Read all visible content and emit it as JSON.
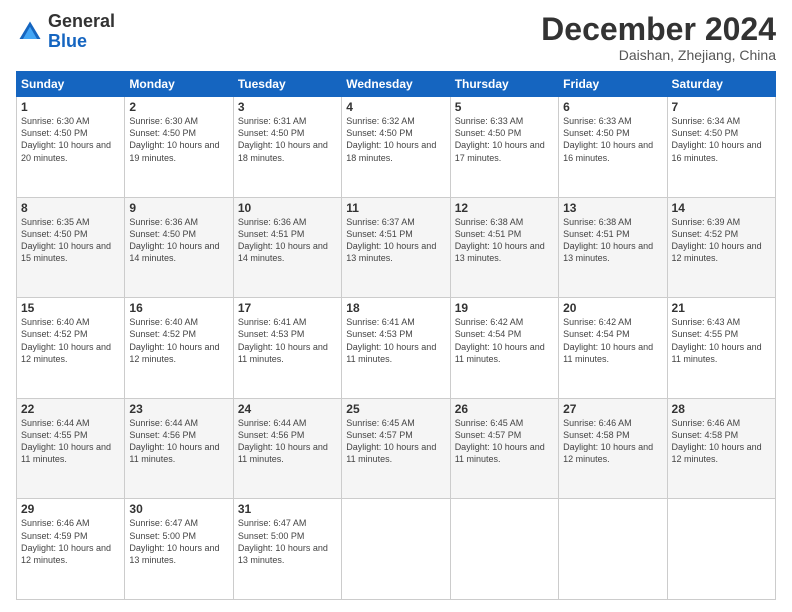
{
  "logo": {
    "general": "General",
    "blue": "Blue"
  },
  "header": {
    "month": "December 2024",
    "location": "Daishan, Zhejiang, China"
  },
  "weekdays": [
    "Sunday",
    "Monday",
    "Tuesday",
    "Wednesday",
    "Thursday",
    "Friday",
    "Saturday"
  ],
  "weeks": [
    [
      {
        "day": "1",
        "sunrise": "6:30 AM",
        "sunset": "4:50 PM",
        "daylight": "10 hours and 20 minutes."
      },
      {
        "day": "2",
        "sunrise": "6:30 AM",
        "sunset": "4:50 PM",
        "daylight": "10 hours and 19 minutes."
      },
      {
        "day": "3",
        "sunrise": "6:31 AM",
        "sunset": "4:50 PM",
        "daylight": "10 hours and 18 minutes."
      },
      {
        "day": "4",
        "sunrise": "6:32 AM",
        "sunset": "4:50 PM",
        "daylight": "10 hours and 18 minutes."
      },
      {
        "day": "5",
        "sunrise": "6:33 AM",
        "sunset": "4:50 PM",
        "daylight": "10 hours and 17 minutes."
      },
      {
        "day": "6",
        "sunrise": "6:33 AM",
        "sunset": "4:50 PM",
        "daylight": "10 hours and 16 minutes."
      },
      {
        "day": "7",
        "sunrise": "6:34 AM",
        "sunset": "4:50 PM",
        "daylight": "10 hours and 16 minutes."
      }
    ],
    [
      {
        "day": "8",
        "sunrise": "6:35 AM",
        "sunset": "4:50 PM",
        "daylight": "10 hours and 15 minutes."
      },
      {
        "day": "9",
        "sunrise": "6:36 AM",
        "sunset": "4:50 PM",
        "daylight": "10 hours and 14 minutes."
      },
      {
        "day": "10",
        "sunrise": "6:36 AM",
        "sunset": "4:51 PM",
        "daylight": "10 hours and 14 minutes."
      },
      {
        "day": "11",
        "sunrise": "6:37 AM",
        "sunset": "4:51 PM",
        "daylight": "10 hours and 13 minutes."
      },
      {
        "day": "12",
        "sunrise": "6:38 AM",
        "sunset": "4:51 PM",
        "daylight": "10 hours and 13 minutes."
      },
      {
        "day": "13",
        "sunrise": "6:38 AM",
        "sunset": "4:51 PM",
        "daylight": "10 hours and 13 minutes."
      },
      {
        "day": "14",
        "sunrise": "6:39 AM",
        "sunset": "4:52 PM",
        "daylight": "10 hours and 12 minutes."
      }
    ],
    [
      {
        "day": "15",
        "sunrise": "6:40 AM",
        "sunset": "4:52 PM",
        "daylight": "10 hours and 12 minutes."
      },
      {
        "day": "16",
        "sunrise": "6:40 AM",
        "sunset": "4:52 PM",
        "daylight": "10 hours and 12 minutes."
      },
      {
        "day": "17",
        "sunrise": "6:41 AM",
        "sunset": "4:53 PM",
        "daylight": "10 hours and 11 minutes."
      },
      {
        "day": "18",
        "sunrise": "6:41 AM",
        "sunset": "4:53 PM",
        "daylight": "10 hours and 11 minutes."
      },
      {
        "day": "19",
        "sunrise": "6:42 AM",
        "sunset": "4:54 PM",
        "daylight": "10 hours and 11 minutes."
      },
      {
        "day": "20",
        "sunrise": "6:42 AM",
        "sunset": "4:54 PM",
        "daylight": "10 hours and 11 minutes."
      },
      {
        "day": "21",
        "sunrise": "6:43 AM",
        "sunset": "4:55 PM",
        "daylight": "10 hours and 11 minutes."
      }
    ],
    [
      {
        "day": "22",
        "sunrise": "6:44 AM",
        "sunset": "4:55 PM",
        "daylight": "10 hours and 11 minutes."
      },
      {
        "day": "23",
        "sunrise": "6:44 AM",
        "sunset": "4:56 PM",
        "daylight": "10 hours and 11 minutes."
      },
      {
        "day": "24",
        "sunrise": "6:44 AM",
        "sunset": "4:56 PM",
        "daylight": "10 hours and 11 minutes."
      },
      {
        "day": "25",
        "sunrise": "6:45 AM",
        "sunset": "4:57 PM",
        "daylight": "10 hours and 11 minutes."
      },
      {
        "day": "26",
        "sunrise": "6:45 AM",
        "sunset": "4:57 PM",
        "daylight": "10 hours and 11 minutes."
      },
      {
        "day": "27",
        "sunrise": "6:46 AM",
        "sunset": "4:58 PM",
        "daylight": "10 hours and 12 minutes."
      },
      {
        "day": "28",
        "sunrise": "6:46 AM",
        "sunset": "4:58 PM",
        "daylight": "10 hours and 12 minutes."
      }
    ],
    [
      {
        "day": "29",
        "sunrise": "6:46 AM",
        "sunset": "4:59 PM",
        "daylight": "10 hours and 12 minutes."
      },
      {
        "day": "30",
        "sunrise": "6:47 AM",
        "sunset": "5:00 PM",
        "daylight": "10 hours and 13 minutes."
      },
      {
        "day": "31",
        "sunrise": "6:47 AM",
        "sunset": "5:00 PM",
        "daylight": "10 hours and 13 minutes."
      },
      null,
      null,
      null,
      null
    ]
  ]
}
